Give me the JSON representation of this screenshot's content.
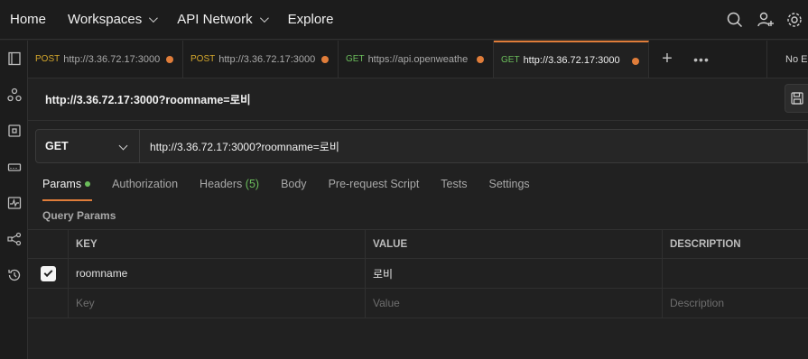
{
  "nav": {
    "items": [
      {
        "label": "Home"
      },
      {
        "label": "Workspaces",
        "dropdown": true
      },
      {
        "label": "API Network",
        "dropdown": true
      },
      {
        "label": "Explore"
      }
    ],
    "right_icons": [
      "search-icon",
      "add-user-icon",
      "settings-icon"
    ]
  },
  "sidebar": {
    "icons": [
      "collections-icon",
      "apis-icon",
      "environments-icon",
      "mock-servers-icon",
      "monitors-icon",
      "flows-icon",
      "history-icon"
    ]
  },
  "tabs": [
    {
      "method": "POST",
      "url": "http://3.36.72.17:3000",
      "unsaved": true
    },
    {
      "method": "POST",
      "url": "http://3.36.72.17:3000",
      "unsaved": true
    },
    {
      "method": "GET",
      "url": "https://api.openweathe",
      "unsaved": true
    },
    {
      "method": "GET",
      "url": "http://3.36.72.17:3000",
      "unsaved": true,
      "active": true
    }
  ],
  "tab_add_label": "+",
  "tab_more_label": "•••",
  "environment": "No E",
  "request": {
    "title": "http://3.36.72.17:3000?roomname=로비",
    "method": "GET",
    "url": "http://3.36.72.17:3000?roomname=로비"
  },
  "subtabs": [
    {
      "label": "Params",
      "active": true,
      "has_dot": true
    },
    {
      "label": "Authorization"
    },
    {
      "label": "Headers",
      "count": "(5)"
    },
    {
      "label": "Body"
    },
    {
      "label": "Pre-request Script"
    },
    {
      "label": "Tests"
    },
    {
      "label": "Settings"
    }
  ],
  "query_params": {
    "title": "Query Params",
    "columns": {
      "key": "KEY",
      "value": "VALUE",
      "description": "DESCRIPTION"
    },
    "rows": [
      {
        "checked": true,
        "key": "roomname",
        "value": "로비",
        "description": ""
      }
    ],
    "placeholders": {
      "key": "Key",
      "value": "Value",
      "description": "Description"
    }
  },
  "colors": {
    "accent": "#e07d3a",
    "post": "#d4a72c",
    "get": "#6bbd5b",
    "background": "#212121"
  }
}
